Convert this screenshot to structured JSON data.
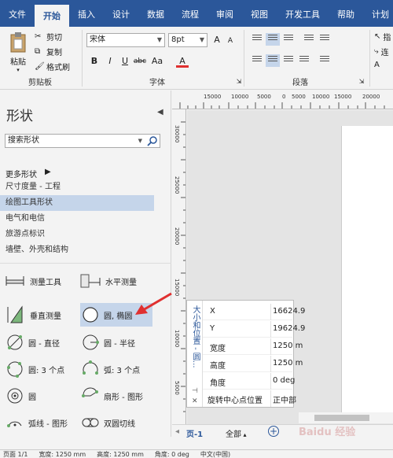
{
  "tabs": [
    "文件",
    "开始",
    "插入",
    "设计",
    "数据",
    "流程",
    "审阅",
    "视图",
    "开发工具",
    "帮助",
    "计划"
  ],
  "active_tab": "开始",
  "ribbon": {
    "paste": "粘贴",
    "cut": "剪切",
    "copy": "复制",
    "format_painter": "格式刷",
    "clipboard_group": "剪贴板",
    "font_name": "宋体",
    "font_size": "8pt",
    "font_group": "字体",
    "paragraph_group": "段落",
    "bold": "B",
    "italic": "I",
    "underline": "U",
    "strike": "abc",
    "case": "Aa",
    "font_color": "A",
    "right_clip_1": "指",
    "right_clip_2": "连",
    "right_clip_3": "A"
  },
  "shapes_pane": {
    "title": "形状",
    "search_placeholder": "搜索形状",
    "more_shapes": "更多形状",
    "stencils": [
      "尺寸度量 - 工程",
      "绘图工具形状",
      "电气和电信",
      "旅游点标识",
      "墙壁、外壳和结构"
    ],
    "selected_stencil": "绘图工具形状",
    "shapes": [
      {
        "label": "测量工具",
        "icon": "measure-tool-icon"
      },
      {
        "label": "水平测量",
        "icon": "horizontal-measure-icon"
      },
      {
        "label": "垂直测量",
        "icon": "vertical-measure-icon"
      },
      {
        "label": "圆, 椭圆",
        "icon": "ellipse-icon"
      },
      {
        "label": "圆 - 直径",
        "icon": "circle-diameter-icon"
      },
      {
        "label": "圆 - 半径",
        "icon": "circle-radius-icon"
      },
      {
        "label": "圆: 3 个点",
        "icon": "circle-3pt-icon"
      },
      {
        "label": "弧: 3 个点",
        "icon": "arc-3pt-icon"
      },
      {
        "label": "圆",
        "icon": "circle-icon"
      },
      {
        "label": "扇形 - 图形",
        "icon": "sector-icon"
      },
      {
        "label": "弧线 - 图形",
        "icon": "arc-shape-icon"
      },
      {
        "label": "双圆切线",
        "icon": "tangent-circles-icon"
      }
    ],
    "selected_shape": "圆, 椭圆"
  },
  "ruler": {
    "top_labels": [
      "15000",
      "10000",
      "5000",
      "0",
      "5000",
      "10000",
      "15000",
      "20000"
    ],
    "left_labels": [
      "30000",
      "25000",
      "20000",
      "15000",
      "10000",
      "5000"
    ]
  },
  "size_position": {
    "title": "大小和位置 - 圆...",
    "rows": [
      {
        "key": "X",
        "value": "16624.9"
      },
      {
        "key": "Y",
        "value": "19624.9"
      },
      {
        "key": "宽度",
        "value": "1250 m"
      },
      {
        "key": "高度",
        "value": "1250 m"
      },
      {
        "key": "角度",
        "value": "0 deg"
      },
      {
        "key": "旋转中心点位置",
        "value": "正中部"
      }
    ]
  },
  "page_tabs": {
    "page": "页-1",
    "all": "全部",
    "add": "+"
  },
  "status_bar": {
    "page": "页面 1/1",
    "width": "宽度: 1250 mm",
    "height": "高度: 1250 mm",
    "angle": "角度: 0 deg",
    "lang": "中文(中国)"
  },
  "watermark": "Baidu 经验",
  "colors": {
    "ribbon_blue": "#2b579a",
    "selection": "#c5d5ea",
    "arrow_red": "#e03030"
  }
}
